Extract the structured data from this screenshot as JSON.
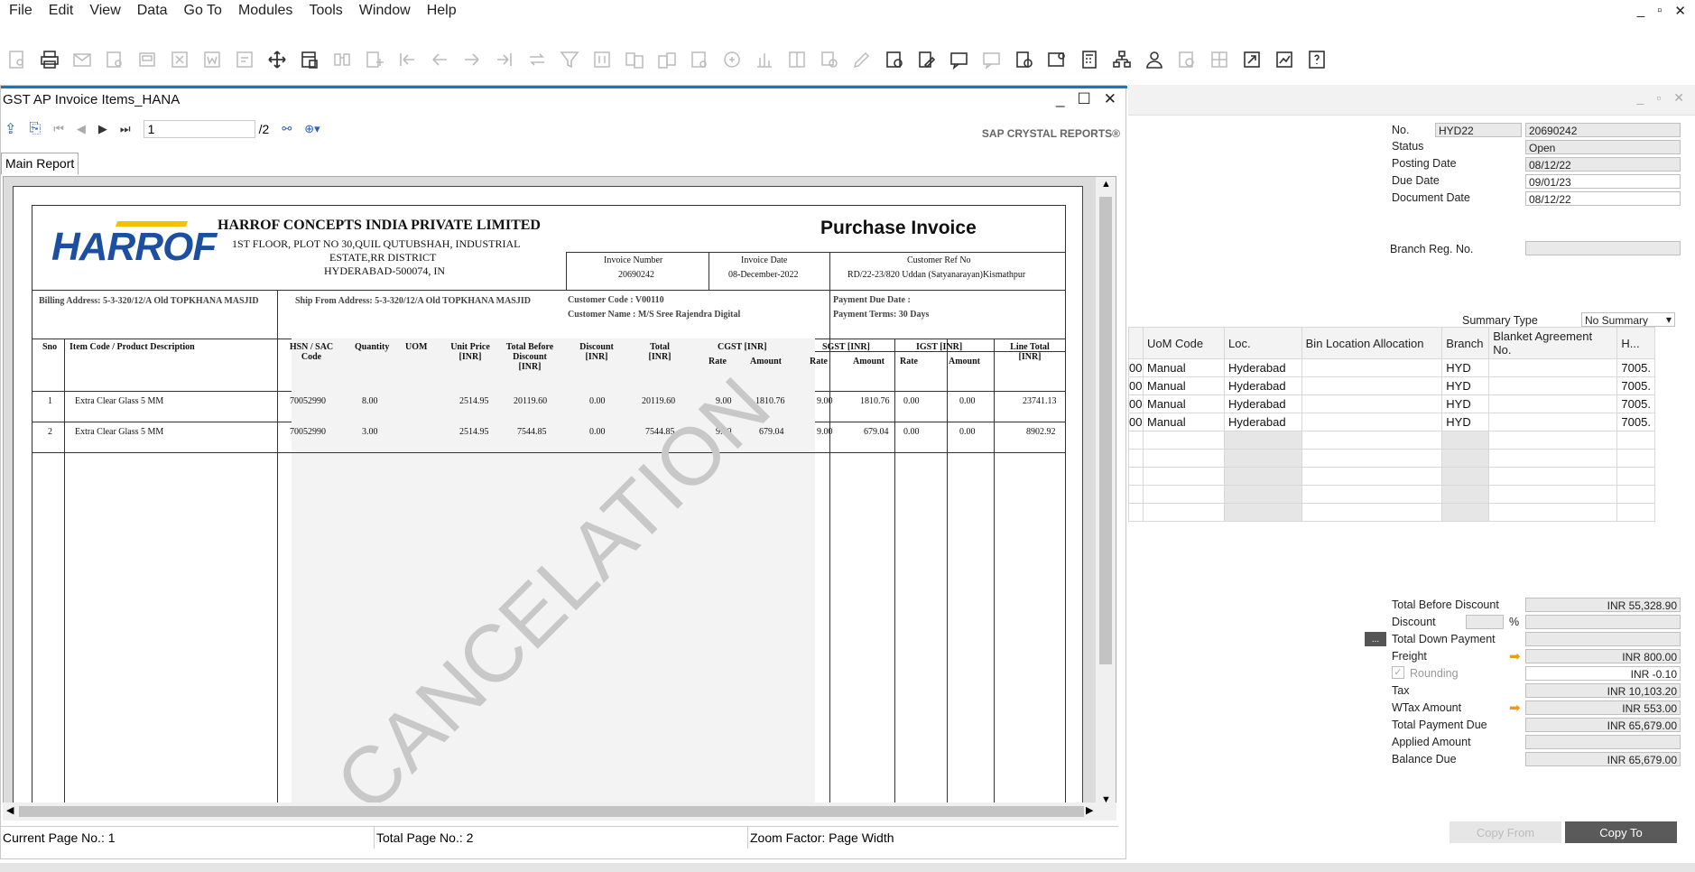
{
  "menu": [
    "File",
    "Edit",
    "View",
    "Data",
    "Go To",
    "Modules",
    "Tools",
    "Window",
    "Help"
  ],
  "report_window": {
    "title": "GST AP Invoice Items_HANA",
    "page_input": "1",
    "page_total": "/2",
    "brand": "SAP CRYSTAL REPORTS®",
    "tab": "Main Report",
    "status": {
      "current": "Current Page No.: 1",
      "total": "Total Page No.: 2",
      "zoom": "Zoom Factor: Page Width"
    }
  },
  "invoice": {
    "logo": "HARROF",
    "company": "HARROF CONCEPTS INDIA PRIVATE LIMITED",
    "addr1": "1ST FLOOR, PLOT NO 30,QUIL QUTUBSHAH, INDUSTRIAL",
    "addr2": "ESTATE,RR DISTRICT",
    "addr3": "HYDERABAD-500074, IN",
    "doc_title": "Purchase Invoice",
    "inv_no_label": "Invoice Number",
    "inv_no": "20690242",
    "inv_date_label": "Invoice Date",
    "inv_date": "08-December-2022",
    "cust_ref_label": "Customer Ref No",
    "cust_ref": "RD/22-23/820 Uddan (Satyanarayan)Kismathpur",
    "billing": "Billing Address: 5-3-320/12/A Old TOPKHANA MASJID",
    "ship": "Ship From Address: 5-3-320/12/A Old TOPKHANA MASJID",
    "cust_code": "Customer Code   : V00110",
    "cust_name": "Customer Name   : M/S Sree Rajendra Digital",
    "pay_due": "Payment Due Date :",
    "pay_terms": "Payment Terms: 30 Days",
    "headers": {
      "sno": "Sno",
      "item": "Item Code / Product Description",
      "hsn": "HSN / SAC Code",
      "qty": "Quantity",
      "uom": "UOM",
      "price": "Unit Price [INR]",
      "tbd": "Total Before Discount [INR]",
      "disc": "Discount [INR]",
      "total": "Total [INR]",
      "cgst": "CGST [INR]",
      "sgst": "SGST [INR]",
      "igst": "IGST [INR]",
      "rate": "Rate",
      "amount": "Amount",
      "line": "Line Total [INR]"
    },
    "rows": [
      {
        "sno": "1",
        "item": "Extra Clear Glass 5 MM",
        "hsn": "70052990",
        "qty": "8.00",
        "price": "2514.95",
        "tbd": "20119.60",
        "disc": "0.00",
        "total": "20119.60",
        "cr": "9.00",
        "ca": "1810.76",
        "sr": "9.00",
        "sa": "1810.76",
        "ir": "0.00",
        "ia": "0.00",
        "line": "23741.13"
      },
      {
        "sno": "2",
        "item": "Extra Clear Glass 5 MM",
        "hsn": "70052990",
        "qty": "3.00",
        "price": "2514.95",
        "tbd": "7544.85",
        "disc": "0.00",
        "total": "7544.85",
        "cr": "9.00",
        "ca": "679.04",
        "sr": "9.00",
        "sa": "679.04",
        "ir": "0.00",
        "ia": "0.00",
        "line": "8902.92"
      }
    ],
    "watermark": "CANCELATION"
  },
  "doc": {
    "labels": {
      "no": "No.",
      "status": "Status",
      "posting": "Posting Date",
      "due": "Due Date",
      "docdate": "Document Date",
      "branchreg": "Branch Reg. No.",
      "summary": "Summary Type"
    },
    "series": "HYD22",
    "number": "20690242",
    "status": "Open",
    "posting": "08/12/22",
    "due": "09/01/23",
    "docdate": "08/12/22",
    "summary": "No Summary"
  },
  "grid": {
    "headers": [
      "UoM Code",
      "Loc.",
      "Bin Location Allocation",
      "Branch",
      "Blanket Agreement No.",
      "H..."
    ],
    "rows": [
      [
        "00",
        "Manual",
        "Hyderabad",
        "",
        "HYD",
        "",
        "7005."
      ],
      [
        "00",
        "Manual",
        "Hyderabad",
        "",
        "HYD",
        "",
        "7005."
      ],
      [
        "00",
        "Manual",
        "Hyderabad",
        "",
        "HYD",
        "",
        "7005."
      ],
      [
        "00",
        "Manual",
        "Hyderabad",
        "",
        "HYD",
        "",
        "7005."
      ]
    ]
  },
  "totals": {
    "labels": {
      "tbd": "Total Before Discount",
      "discount": "Discount",
      "pct": "%",
      "tdp": "Total Down Payment",
      "freight": "Freight",
      "rounding": "Rounding",
      "tax": "Tax",
      "wtax": "WTax Amount",
      "tpd": "Total Payment Due",
      "applied": "Applied Amount",
      "balance": "Balance Due"
    },
    "tbd": "INR 55,328.90",
    "freight": "INR 800.00",
    "rounding": "INR -0.10",
    "tax": "INR 10,103.20",
    "wtax": "INR 553.00",
    "tpd": "INR 65,679.00",
    "balance": "INR 65,679.00"
  },
  "buttons": {
    "copy_from": "Copy From",
    "copy_to": "Copy To",
    "ellipsis": "..."
  }
}
